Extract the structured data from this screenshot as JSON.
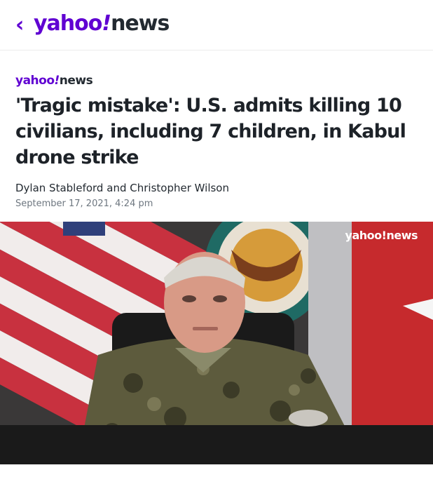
{
  "header": {
    "back_icon": "chevron-left-icon",
    "logo_yahoo": "yahoo",
    "logo_bang": "!",
    "logo_news": "news"
  },
  "article": {
    "source_yahoo": "yahoo",
    "source_bang": "!",
    "source_news": "news",
    "headline": "'Tragic mistake': U.S. admits killing 10 civilians, including 7 children, in Kabul drone strike",
    "author_1": "Dylan Stableford",
    "conjunction": "and",
    "author_2": "Christopher Wilson",
    "timestamp": "September 17, 2021, 4:24 pm"
  },
  "hero_image": {
    "watermark": "yahoo!news"
  },
  "colors": {
    "brand_purple": "#6001d2",
    "text_dark": "#1d2228",
    "text_muted": "#6e7780"
  }
}
